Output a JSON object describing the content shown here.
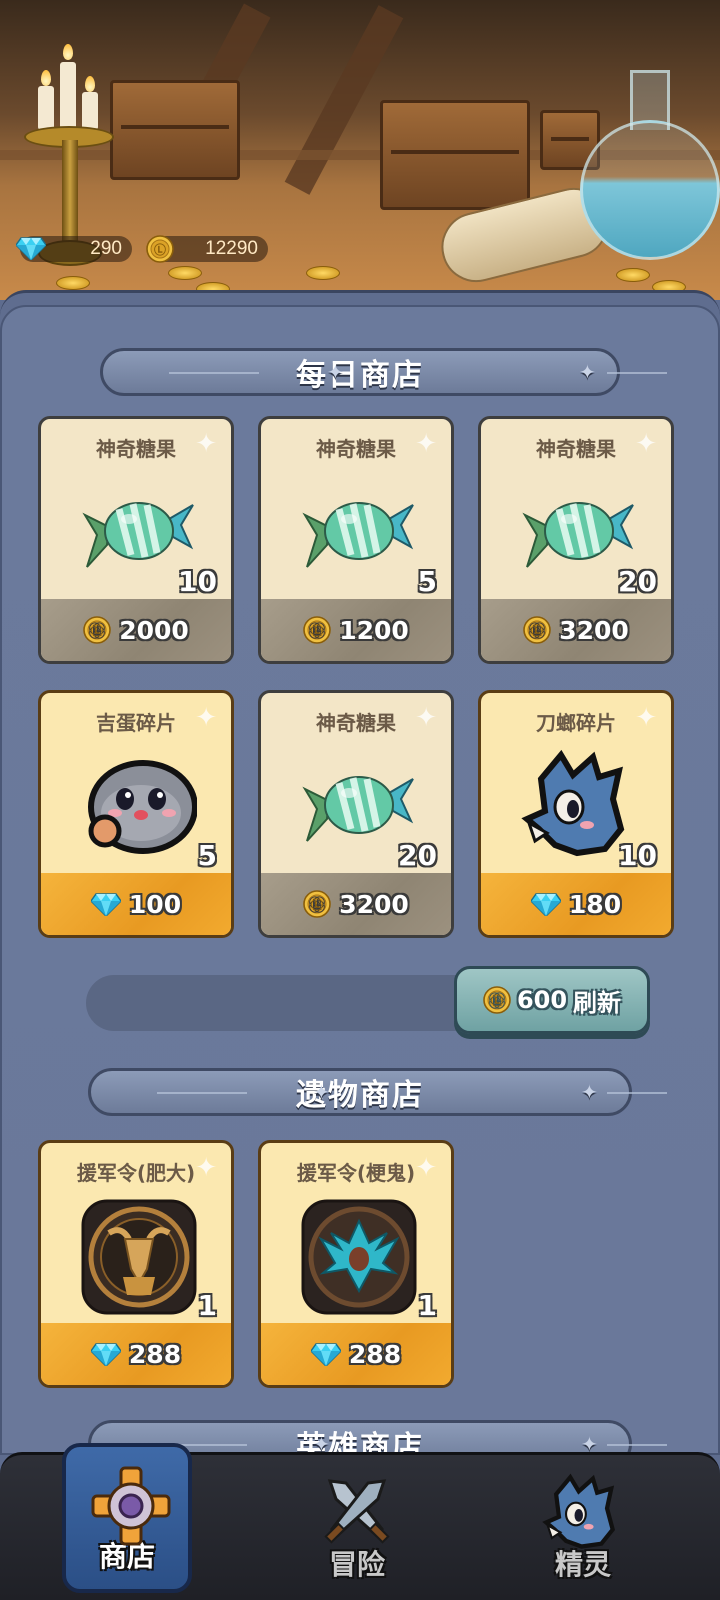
{
  "currency": {
    "gems": "290",
    "coins": "12290",
    "gem_icon": "diamond-icon",
    "coin_icon": "gold-coin-icon"
  },
  "daily_shop": {
    "title": "每日商店",
    "items": [
      {
        "name": "神奇糖果",
        "qty": "10",
        "price": "2000",
        "currency": "coin",
        "icon": "candy-icon",
        "style": "gray"
      },
      {
        "name": "神奇糖果",
        "qty": "5",
        "price": "1200",
        "currency": "coin",
        "icon": "candy-icon",
        "style": "gray"
      },
      {
        "name": "神奇糖果",
        "qty": "20",
        "price": "3200",
        "currency": "coin",
        "icon": "candy-icon",
        "style": "gray"
      },
      {
        "name": "吉蛋碎片",
        "qty": "5",
        "price": "100",
        "currency": "gem",
        "icon": "blob-creature-icon",
        "style": "gold"
      },
      {
        "name": "神奇糖果",
        "qty": "20",
        "price": "3200",
        "currency": "coin",
        "icon": "candy-icon",
        "style": "gray"
      },
      {
        "name": "刀螂碎片",
        "qty": "10",
        "price": "180",
        "currency": "gem",
        "icon": "blue-creature-icon",
        "style": "gold"
      }
    ],
    "refresh": {
      "cost": "600",
      "label": "刷新"
    }
  },
  "relic_shop": {
    "title": "遗物商店",
    "items": [
      {
        "name": "援军令(肥大)",
        "qty": "1",
        "price": "288",
        "currency": "gem",
        "icon": "ram-emblem-icon",
        "style": "gold"
      },
      {
        "name": "援军令(梗鬼)",
        "qty": "1",
        "price": "288",
        "currency": "gem",
        "icon": "winged-emblem-icon",
        "style": "gold"
      }
    ]
  },
  "hero_shop": {
    "title": "英雄商店"
  },
  "nav": {
    "items": [
      {
        "label": "商店",
        "icon": "shop-gear-icon",
        "active": true
      },
      {
        "label": "冒险",
        "icon": "crossed-swords-icon",
        "active": false
      },
      {
        "label": "精灵",
        "icon": "spirit-creature-icon",
        "active": false
      }
    ]
  },
  "colors": {
    "panel": "#6b7a9c",
    "gold_card": "#fbe8b0",
    "gray_card": "#f3e6c7",
    "price_gold": "#f0a52c",
    "price_gray": "#9c917f",
    "refresh_btn": "#8fb9b9",
    "nav_active": "#3a62a0"
  }
}
